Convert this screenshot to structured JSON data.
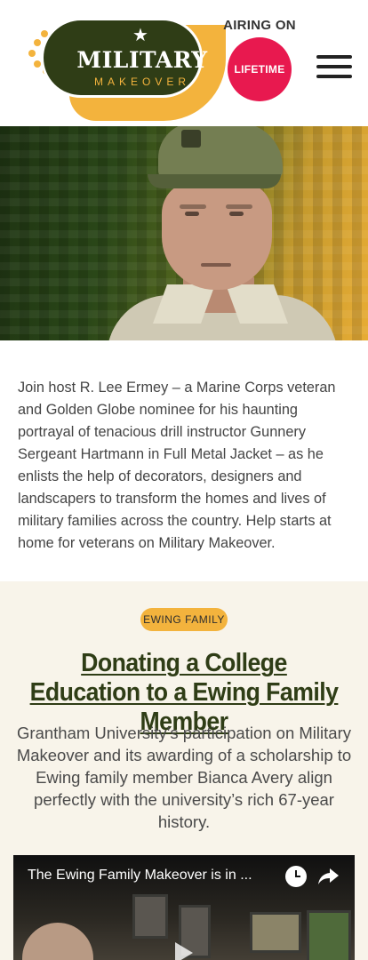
{
  "header": {
    "logo": {
      "title": "MILITARY",
      "subtitle": "MAKEOVER"
    },
    "airing": {
      "label": "AIRING ON",
      "network": "LIFETIME"
    },
    "menu_icon": "hamburger-menu-icon"
  },
  "hero": {
    "image": "host-portrait"
  },
  "intro": {
    "text": "Join host R. Lee Ermey – a Marine Corps veteran and Golden Globe nominee for his haunting portrayal of tenacious drill instructor Gunnery Sergeant Hartmann in Full Metal Jacket – as he enlists the help of decorators, designers and landscapers to transform the homes and lives of military families across the country. Help starts at home for veterans on Military Makeover."
  },
  "feature": {
    "tag": "EWING FAMILY",
    "headline": "Donating a College Education to a Ewing Family Member",
    "summary": "Grantham University’s participation on Military Makeover and its awarding of a scholarship to Ewing family member Bianca Avery align perfectly with the university’s rich 67-year history.",
    "video": {
      "title": "The Ewing Family Makeover is in ...",
      "icons": [
        "clock-icon",
        "share-icon",
        "play-icon"
      ]
    }
  },
  "colors": {
    "brand_green": "#2f3d16",
    "brand_yellow": "#f3b33d",
    "lifetime_pink": "#e8194f",
    "section_bg": "#f8f4ea"
  }
}
